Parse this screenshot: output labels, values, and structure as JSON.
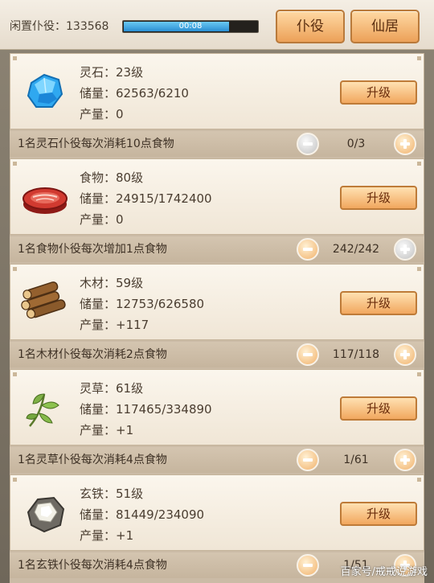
{
  "header": {
    "idle_label": "闲置仆役：133568",
    "timer": "00:08",
    "timer_progress": 0.79,
    "tabs": [
      "仆役",
      "仙居"
    ]
  },
  "resources": [
    {
      "icon": "spirit-stone-icon",
      "level": "灵石：23级",
      "storage": "储量：62563/6210",
      "output": "产量：0",
      "upgrade": "升级",
      "cost": "1名灵石仆役每次消耗10点食物",
      "count": "0/3",
      "minus_state": "gray",
      "plus_state": "orange"
    },
    {
      "icon": "meat-icon",
      "level": "食物：80级",
      "storage": "储量：24915/1742400",
      "output": "产量：0",
      "upgrade": "升级",
      "cost": "1名食物仆役每次增加1点食物",
      "count": "242/242",
      "minus_state": "orange",
      "plus_state": "gray"
    },
    {
      "icon": "wood-logs-icon",
      "level": "木材：59级",
      "storage": "储量：12753/626580",
      "output": "产量：+117",
      "upgrade": "升级",
      "cost": "1名木材仆役每次消耗2点食物",
      "count": "117/118",
      "minus_state": "orange",
      "plus_state": "orange"
    },
    {
      "icon": "herb-leaf-icon",
      "level": "灵草：61级",
      "storage": "储量：117465/334890",
      "output": "产量：+1",
      "upgrade": "升级",
      "cost": "1名灵草仆役每次消耗4点食物",
      "count": "1/61",
      "minus_state": "orange",
      "plus_state": "orange"
    },
    {
      "icon": "iron-ore-icon",
      "level": "玄铁：51级",
      "storage": "储量：81449/234090",
      "output": "产量：+1",
      "upgrade": "升级",
      "cost": "1名玄铁仆役每次消耗4点食物",
      "count": "1/51",
      "minus_state": "orange",
      "plus_state": "orange"
    }
  ],
  "watermark": "百家号/戒戒说游戏"
}
